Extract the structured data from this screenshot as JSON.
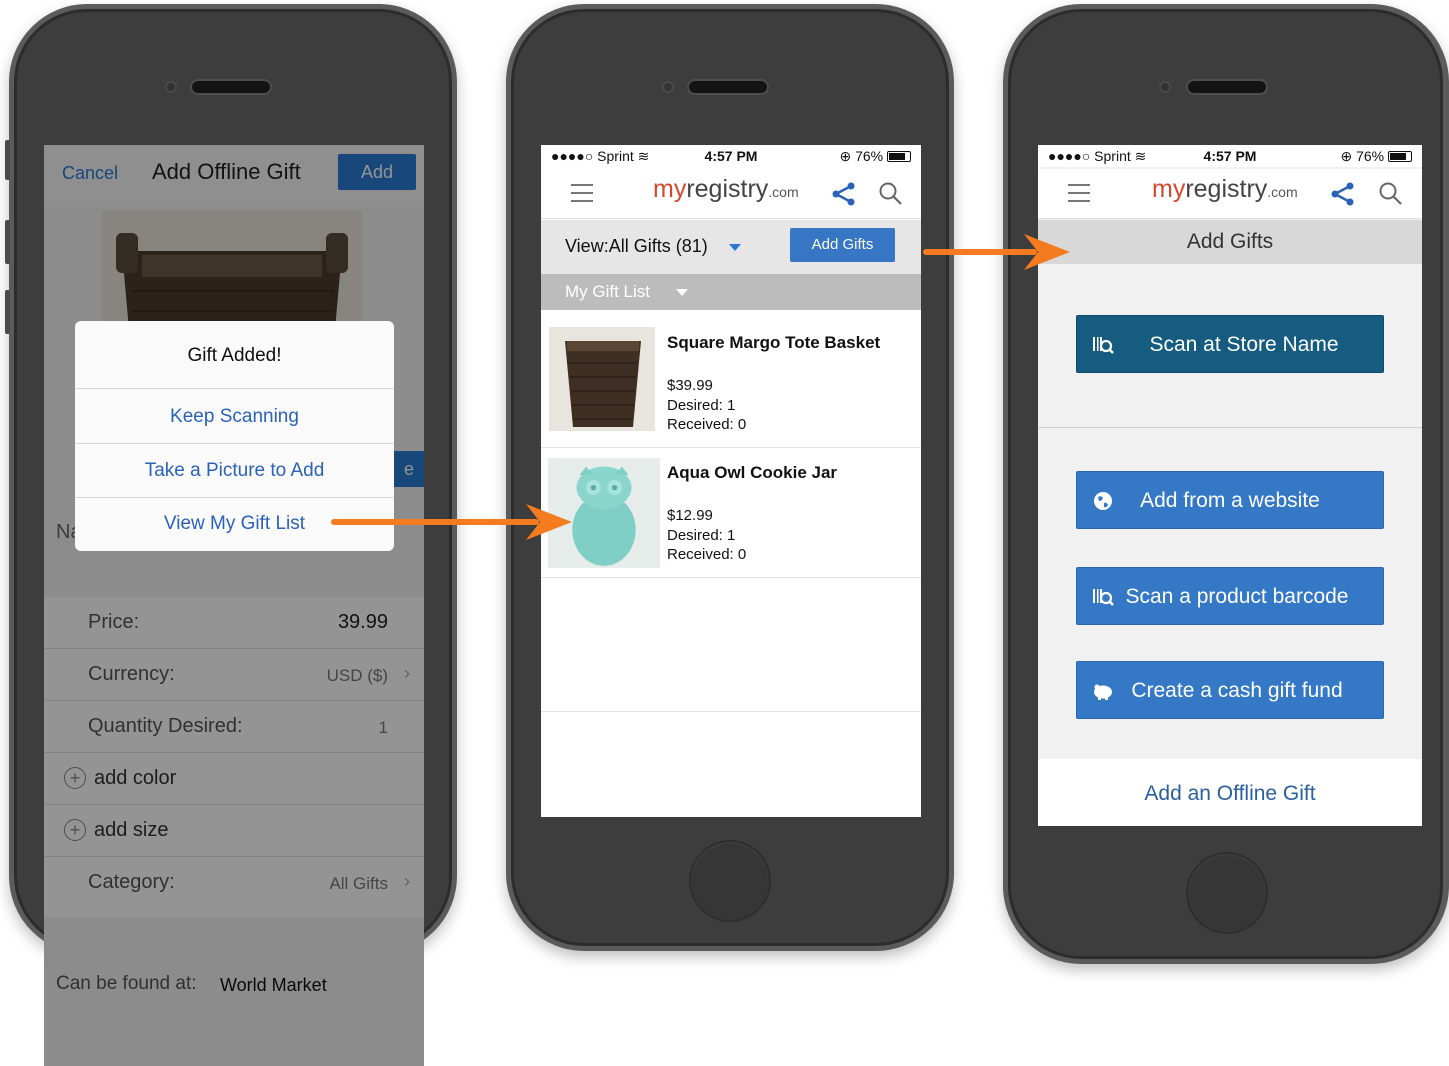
{
  "screen1": {
    "nav": {
      "cancel": "Cancel",
      "title": "Add Offline Gift",
      "add": "Add"
    },
    "side_button_partial": "e",
    "name_label_partial": "Na",
    "dialog": {
      "title": "Gift Added!",
      "buttons": [
        "Keep Scanning",
        "Take a Picture to Add",
        "View My Gift List"
      ]
    },
    "form": {
      "price_label": "Price:",
      "price_value": "39.99",
      "currency_label": "Currency:",
      "currency_value": "USD ($)",
      "quantity_label": "Quantity Desired:",
      "quantity_value": "1",
      "add_color": "add color",
      "add_size": "add size",
      "category_label": "Category:",
      "category_value": "All Gifts"
    },
    "found_label": "Can be found at:",
    "found_value": "World Market"
  },
  "status_bar": {
    "carrier": "●●●●○ Sprint",
    "time": "4:57 PM",
    "battery": "76%"
  },
  "brand": {
    "my": "my",
    "registry": "registry",
    "com": ".com"
  },
  "screen2": {
    "view_label": "View:All Gifts (81)",
    "add_gifts": "Add Gifts",
    "list_label": "My Gift List",
    "items": [
      {
        "name": "Square Margo Tote Basket",
        "price": "$39.99",
        "desired": "Desired: 1",
        "received": "Received: 0"
      },
      {
        "name": "Aqua Owl Cookie Jar",
        "price": "$12.99",
        "desired": "Desired: 1",
        "received": "Received: 0"
      }
    ]
  },
  "screen3": {
    "header": "Add Gifts",
    "scan_store": "Scan at Store Name",
    "add_website": "Add from a website",
    "scan_barcode": "Scan a product barcode",
    "cash_fund": "Create a cash gift fund",
    "offline": "Add an Offline Gift"
  },
  "colors": {
    "accent_blue": "#3478c6",
    "dark_teal": "#165c80",
    "arrow_orange": "#f47b20",
    "brand_red": "#d4492e"
  }
}
